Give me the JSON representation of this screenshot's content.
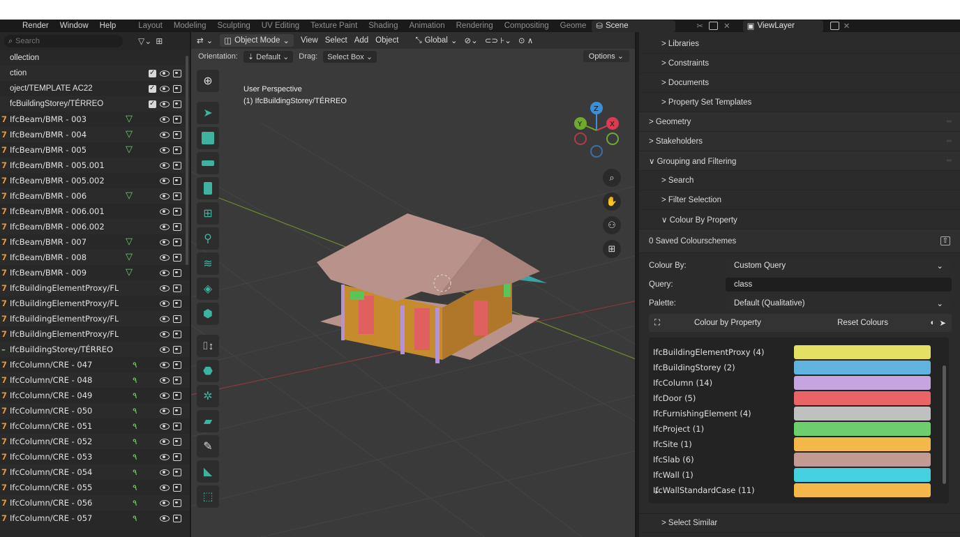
{
  "menu": [
    "Render",
    "Window",
    "Help"
  ],
  "workspaces": [
    "Layout",
    "Modeling",
    "Sculpting",
    "UV Editing",
    "Texture Paint",
    "Shading",
    "Animation",
    "Rendering",
    "Compositing",
    "Geome"
  ],
  "active_workspace": "Layout",
  "scene": "Scene",
  "view_layer": "ViewLayer",
  "outliner": {
    "search_placeholder": "Search",
    "rows": [
      {
        "label": "ollection",
        "mark": "",
        "type": "header",
        "controls": "none"
      },
      {
        "label": "ction",
        "mark": "",
        "type": "header",
        "controls": "chk"
      },
      {
        "label": "oject/TEMPLATE AC22",
        "mark": "",
        "type": "header",
        "controls": "chk"
      },
      {
        "label": "fcBuildingStorey/TÉRREO",
        "mark": "",
        "type": "header",
        "controls": "chk"
      },
      {
        "label": "IfcBeam/BMR - 003",
        "mark": "7",
        "filter": true
      },
      {
        "label": "IfcBeam/BMR - 004",
        "mark": "7",
        "filter": true
      },
      {
        "label": "IfcBeam/BMR - 005",
        "mark": "7",
        "filter": true
      },
      {
        "label": "IfcBeam/BMR - 005.001",
        "mark": "7"
      },
      {
        "label": "IfcBeam/BMR - 005.002",
        "mark": "7"
      },
      {
        "label": "IfcBeam/BMR - 006",
        "mark": "7",
        "filter": true
      },
      {
        "label": "IfcBeam/BMR - 006.001",
        "mark": "7"
      },
      {
        "label": "IfcBeam/BMR - 006.002",
        "mark": "7"
      },
      {
        "label": "IfcBeam/BMR - 007",
        "mark": "7",
        "filter": true
      },
      {
        "label": "IfcBeam/BMR - 008",
        "mark": "7",
        "filter": true
      },
      {
        "label": "IfcBeam/BMR - 009",
        "mark": "7",
        "filter": true
      },
      {
        "label": "IfcBuildingElementProxy/FL",
        "mark": "7"
      },
      {
        "label": "IfcBuildingElementProxy/FL",
        "mark": "7"
      },
      {
        "label": "IfcBuildingElementProxy/FL",
        "mark": "7"
      },
      {
        "label": "IfcBuildingElementProxy/FL",
        "mark": "7"
      },
      {
        "label": "IfcBuildingStorey/TÉRREO",
        "mark": "–",
        "green": true
      },
      {
        "label": "IfcColumn/CRE - 047",
        "mark": "7",
        "col": true
      },
      {
        "label": "IfcColumn/CRE - 048",
        "mark": "7",
        "col": true
      },
      {
        "label": "IfcColumn/CRE - 049",
        "mark": "7",
        "col": true
      },
      {
        "label": "IfcColumn/CRE - 050",
        "mark": "7",
        "col": true
      },
      {
        "label": "IfcColumn/CRE - 051",
        "mark": "7",
        "col": true
      },
      {
        "label": "IfcColumn/CRE - 052",
        "mark": "7",
        "col": true
      },
      {
        "label": "IfcColumn/CRE - 053",
        "mark": "7",
        "col": true
      },
      {
        "label": "IfcColumn/CRE - 054",
        "mark": "7",
        "col": true
      },
      {
        "label": "IfcColumn/CRE - 055",
        "mark": "7",
        "col": true
      },
      {
        "label": "IfcColumn/CRE - 056",
        "mark": "7",
        "col": true
      },
      {
        "label": "IfcColumn/CRE - 057",
        "mark": "7",
        "col": true
      }
    ]
  },
  "viewport": {
    "mode": "Object Mode",
    "menus": [
      "View",
      "Select",
      "Add",
      "Object"
    ],
    "transform": "Global",
    "orientation_label": "Orientation:",
    "orientation_value": "Default",
    "drag_label": "Drag:",
    "drag_value": "Select Box",
    "options": "Options",
    "overlay_line1": "User Perspective",
    "overlay_line2": "(1) IfcBuildingStorey/TÉRREO",
    "gizmo": {
      "z": "Z",
      "y": "Y",
      "x": "X"
    }
  },
  "properties": {
    "tree": [
      {
        "label": "> Libraries",
        "level": 1
      },
      {
        "label": "> Constraints",
        "level": 1
      },
      {
        "label": "> Documents",
        "level": 1
      },
      {
        "label": "> Property Set Templates",
        "level": 1
      },
      {
        "label": "> Geometry",
        "level": 0
      },
      {
        "label": "> Stakeholders",
        "level": 0
      },
      {
        "label": "∨ Grouping and Filtering",
        "level": 0
      },
      {
        "label": "> Search",
        "level": 1
      },
      {
        "label": "> Filter Selection",
        "level": 1
      },
      {
        "label": "∨ Colour By Property",
        "level": 1
      }
    ],
    "saved_schemes": "0 Saved Colourschemes",
    "colour_by_label": "Colour By:",
    "colour_by_value": "Custom Query",
    "query_label": "Query:",
    "query_value": "class",
    "palette_label": "Palette:",
    "palette_value": "Default (Qualitative)",
    "colour_by_property_btn": "Colour by Property",
    "reset_colours_btn": "Reset Colours",
    "legend": [
      {
        "label": "IfcBuildingElementProxy (4)",
        "color": "#e3e063"
      },
      {
        "label": "IfcBuildingStorey (2)",
        "color": "#5fb3de"
      },
      {
        "label": "IfcColumn (14)",
        "color": "#c6a4e0"
      },
      {
        "label": "IfcDoor (5)",
        "color": "#ea6466"
      },
      {
        "label": "IfcFurnishingElement (4)",
        "color": "#c0c0c0"
      },
      {
        "label": "IfcProject (1)",
        "color": "#6cce6c"
      },
      {
        "label": "IfcSite (1)",
        "color": "#f4b74a"
      },
      {
        "label": "IfcSlab (6)",
        "color": "#c29a93"
      },
      {
        "label": "IfcWall (1)",
        "color": "#45d0e0"
      },
      {
        "label": "IfcWallStandardCase (11)",
        "color": "#f4b74a"
      }
    ],
    "select_similar": "> Select Similar"
  }
}
